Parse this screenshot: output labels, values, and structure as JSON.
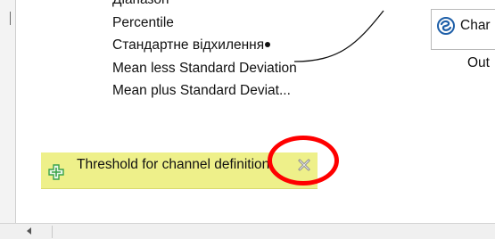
{
  "statistics": [
    "Діапазон",
    "Percentile",
    "Стандартне відхилення",
    "Mean less Standard Deviation",
    "Mean plus Standard Deviat..."
  ],
  "channel_node": {
    "label_visible": "Char",
    "output_label": "Out",
    "icon": "channel-swirl-icon"
  },
  "note": {
    "text": "Threshold for channel definition",
    "add_icon": "plus-icon",
    "close_icon": "close-icon"
  },
  "colors": {
    "note_background": "#eef08a",
    "highlight": "#ff0000",
    "channel_icon": "#1e5fa8",
    "plus_icon": "#3aa34a"
  }
}
